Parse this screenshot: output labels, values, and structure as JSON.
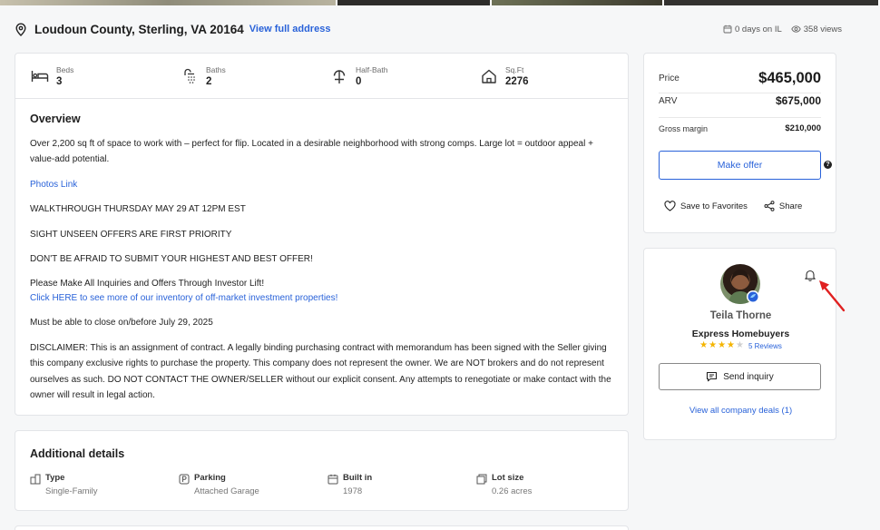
{
  "colors": {
    "accent": "#2962d9",
    "star": "#f4b400",
    "annotation": "#e02020"
  },
  "header": {
    "address": "Loudoun County, Sterling, VA 20164",
    "view_full_address": "View full address",
    "days_on": "0 days on IL",
    "views": "358 views",
    "icons": [
      "map-pin-icon",
      "calendar-icon",
      "eye-icon"
    ]
  },
  "stats": [
    {
      "label": "Beds",
      "value": "3",
      "icon": "bed-icon"
    },
    {
      "label": "Baths",
      "value": "2",
      "icon": "shower-icon"
    },
    {
      "label": "Half-Bath",
      "value": "0",
      "icon": "faucet-icon"
    },
    {
      "label": "Sq.Ft",
      "value": "2276",
      "icon": "house-icon"
    }
  ],
  "overview": {
    "title": "Overview",
    "p1": "Over 2,200 sq ft of space to work with – perfect for flip. Located in a desirable neighborhood with strong comps. Large lot = outdoor appeal + value-add potential.",
    "photos_link": "Photos Link",
    "walkthrough": "WALKTHROUGH THURSDAY MAY 29 AT 12PM EST",
    "sight_unseen": "SIGHT UNSEEN OFFERS ARE FIRST PRIORITY",
    "dont_be_afraid": "DON'T BE AFRAID TO SUBMIT YOUR HIGHEST AND BEST OFFER!",
    "inquiries": "Please Make All Inquiries and Offers Through Investor Lift!",
    "inventory_link": "Click HERE to see more of our inventory of off-market investment properties!",
    "close_by": "Must be able to close on/before July 29, 2025",
    "disclaimer": "DISCLAIMER: This is an assignment of contract. A legally binding purchasing contract with memorandum has been signed with the Seller giving this company exclusive rights to purchase the property. This company does not represent the owner. We are NOT brokers and do not represent ourselves as such. DO NOT CONTACT THE OWNER/SELLER without our explicit consent. Any attempts to renegotiate or make contact with the owner will result in legal action."
  },
  "additional": {
    "title": "Additional details",
    "items": [
      {
        "label": "Type",
        "value": "Single-Family",
        "icon": "building-icon"
      },
      {
        "label": "Parking",
        "value": "Attached Garage",
        "icon": "parking-icon"
      },
      {
        "label": "Built in",
        "value": "1978",
        "icon": "calendar-icon"
      },
      {
        "label": "Lot size",
        "value": "0.26 acres",
        "icon": "lot-icon"
      }
    ]
  },
  "pricing": {
    "price_label": "Price",
    "price": "$465,000",
    "arv_label": "ARV",
    "arv": "$675,000",
    "margin_label": "Gross margin",
    "margin": "$210,000",
    "offer_button": "Make offer",
    "help": "?",
    "favorites": "Save to Favorites",
    "share": "Share"
  },
  "agent": {
    "name": "Teila Thorne",
    "company": "Express Homebuyers",
    "rating": 4,
    "reviews": "5 Reviews",
    "send_inquiry": "Send inquiry",
    "view_deals": "View all company deals (1)"
  }
}
